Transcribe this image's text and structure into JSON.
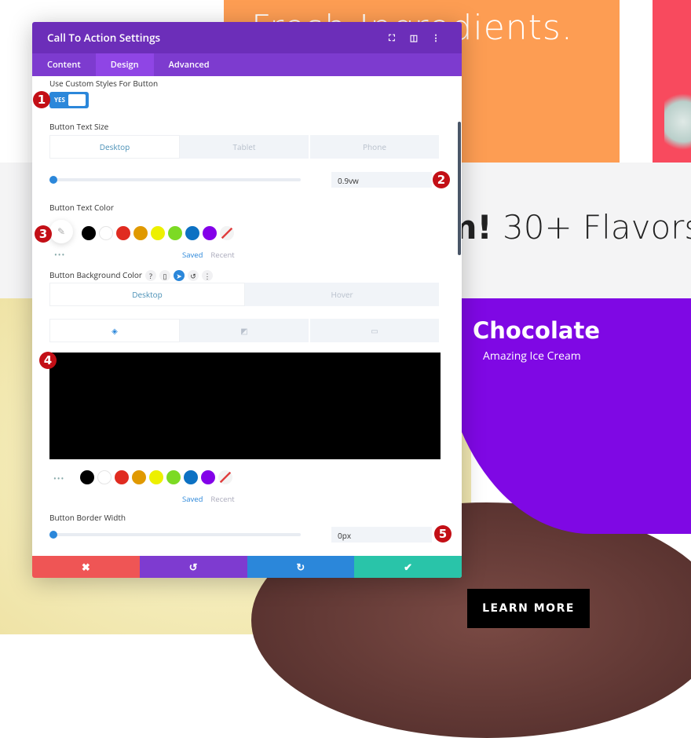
{
  "background": {
    "hero_text": "Fresh Ingredients.",
    "flavors_bold": "mm!",
    "flavors_text": " 30+ Flavors",
    "card_title": "Chocolate",
    "card_subtitle": "Amazing Ice Cream",
    "cta": "LEARN MORE"
  },
  "panel": {
    "title": "Call To Action Settings",
    "header_icons": [
      "expand-icon",
      "sidebar-icon",
      "more-icon"
    ],
    "tabs": [
      {
        "label": "Content"
      },
      {
        "label": "Design",
        "active": true
      },
      {
        "label": "Advanced"
      }
    ],
    "custom_styles": {
      "label": "Use Custom Styles For Button",
      "value": "YES"
    },
    "text_size": {
      "label": "Button Text Size",
      "devices": [
        "Desktop",
        "Tablet",
        "Phone"
      ],
      "value": "0.9vw"
    },
    "text_color": {
      "label": "Button Text Color"
    },
    "bg_color": {
      "label": "Button Background Color",
      "states": [
        "Desktop",
        "Hover"
      ],
      "value": "#000000"
    },
    "palette": [
      "#000000",
      "#ffffff",
      "#e02b20",
      "#e09900",
      "#edf000",
      "#7cda24",
      "#0c71c3",
      "#8300e9"
    ],
    "saved": "Saved",
    "recent": "Recent",
    "border_width": {
      "label": "Button Border Width",
      "value": "0px"
    },
    "badges": [
      "1",
      "2",
      "3",
      "4",
      "5"
    ],
    "footer": {
      "cancel": "✖",
      "undo": "↺",
      "redo": "↻",
      "save": "✔"
    }
  }
}
